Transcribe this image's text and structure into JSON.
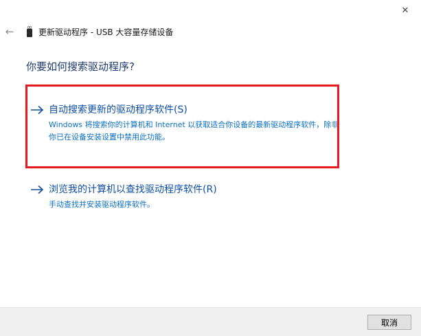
{
  "window": {
    "close_glyph": "✕",
    "back_glyph": "←",
    "title": "更新驱动程序 - USB 大容量存储设备"
  },
  "main": {
    "heading": "你要如何搜索驱动程序?",
    "options": [
      {
        "label": "自动搜索更新的驱动程序软件(S)",
        "description": "Windows 将搜索你的计算机和 Internet 以获取适合你设备的最新驱动程序软件，除非你已在设备安装设置中禁用此功能。",
        "highlighted": true
      },
      {
        "label": "浏览我的计算机以查找驱动程序软件(R)",
        "description": "手动查找并安装驱动程序软件。",
        "highlighted": false
      }
    ]
  },
  "footer": {
    "cancel_label": "取消"
  },
  "colors": {
    "link": "#0e4fa3",
    "description": "#0a6fc4",
    "heading": "#1e3a6e",
    "highlight": "#e8181f"
  },
  "icons": {
    "device": "usb-device-icon",
    "option_arrow": "arrow-right-icon",
    "back": "back-arrow-icon",
    "close": "close-icon"
  }
}
